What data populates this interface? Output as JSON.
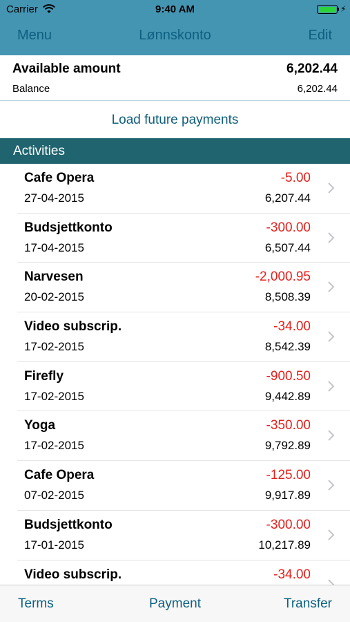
{
  "status": {
    "carrier": "Carrier",
    "time": "9:40 AM"
  },
  "nav": {
    "menu_label": "Menu",
    "title": "Lønnskonto",
    "edit_label": "Edit"
  },
  "summary": {
    "available_label": "Available amount",
    "available_value": "6,202.44",
    "balance_label": "Balance",
    "balance_value": "6,202.44"
  },
  "load_future_label": "Load future payments",
  "activities": {
    "header": "Activities",
    "items": [
      {
        "name": "Cafe Opera",
        "date": "27-04-2015",
        "amount": "-5.00",
        "balance": "6,207.44"
      },
      {
        "name": "Budsjettkonto",
        "date": "17-04-2015",
        "amount": "-300.00",
        "balance": "6,507.44"
      },
      {
        "name": "Narvesen",
        "date": "20-02-2015",
        "amount": "-2,000.95",
        "balance": "8,508.39"
      },
      {
        "name": "Video subscrip.",
        "date": "17-02-2015",
        "amount": "-34.00",
        "balance": "8,542.39"
      },
      {
        "name": "Firefly",
        "date": "17-02-2015",
        "amount": "-900.50",
        "balance": "9,442.89"
      },
      {
        "name": "Yoga",
        "date": "17-02-2015",
        "amount": "-350.00",
        "balance": "9,792.89"
      },
      {
        "name": "Cafe Opera",
        "date": "07-02-2015",
        "amount": "-125.00",
        "balance": "9,917.89"
      },
      {
        "name": "Budsjettkonto",
        "date": "17-01-2015",
        "amount": "-300.00",
        "balance": "10,217.89"
      },
      {
        "name": "Video subscrip.",
        "date": "",
        "amount": "-34.00",
        "balance": ""
      }
    ]
  },
  "tabs": {
    "terms": "Terms",
    "payment": "Payment",
    "transfer": "Transfer"
  },
  "colors": {
    "nav_background": "#4495b2",
    "section_background": "#1f646e",
    "accent_text": "#0c5f80",
    "negative_amount": "#e8201c",
    "battery": "#2bd23a"
  },
  "icons": [
    "wifi-icon",
    "battery-icon",
    "charging-bolt-icon",
    "chevron-right-icon"
  ]
}
